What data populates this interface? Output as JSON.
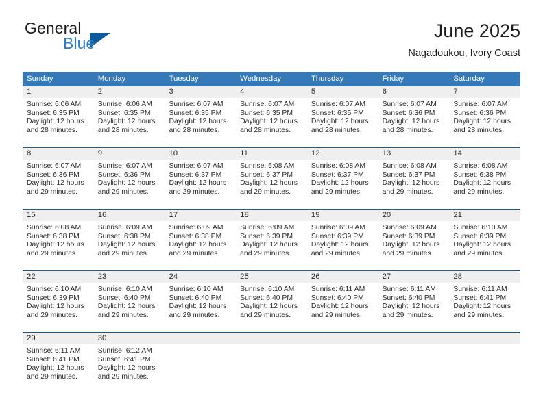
{
  "brand": {
    "name_part1": "General",
    "name_part2": "Blue",
    "triangle_color": "#0d5a9e",
    "blue_text_color": "#2b7cc4"
  },
  "header": {
    "title": "June 2025",
    "subtitle": "Nagadoukou, Ivory Coast"
  },
  "colors": {
    "header_band": "#3679b9",
    "week_rule": "#14609f",
    "day_band": "#efefef",
    "text": "#2b2b2b"
  },
  "weekdays": [
    "Sunday",
    "Monday",
    "Tuesday",
    "Wednesday",
    "Thursday",
    "Friday",
    "Saturday"
  ],
  "weeks": [
    {
      "days": [
        {
          "num": "1",
          "sunrise": "Sunrise: 6:06 AM",
          "sunset": "Sunset: 6:35 PM",
          "daylight1": "Daylight: 12 hours",
          "daylight2": "and 28 minutes."
        },
        {
          "num": "2",
          "sunrise": "Sunrise: 6:06 AM",
          "sunset": "Sunset: 6:35 PM",
          "daylight1": "Daylight: 12 hours",
          "daylight2": "and 28 minutes."
        },
        {
          "num": "3",
          "sunrise": "Sunrise: 6:07 AM",
          "sunset": "Sunset: 6:35 PM",
          "daylight1": "Daylight: 12 hours",
          "daylight2": "and 28 minutes."
        },
        {
          "num": "4",
          "sunrise": "Sunrise: 6:07 AM",
          "sunset": "Sunset: 6:35 PM",
          "daylight1": "Daylight: 12 hours",
          "daylight2": "and 28 minutes."
        },
        {
          "num": "5",
          "sunrise": "Sunrise: 6:07 AM",
          "sunset": "Sunset: 6:35 PM",
          "daylight1": "Daylight: 12 hours",
          "daylight2": "and 28 minutes."
        },
        {
          "num": "6",
          "sunrise": "Sunrise: 6:07 AM",
          "sunset": "Sunset: 6:36 PM",
          "daylight1": "Daylight: 12 hours",
          "daylight2": "and 28 minutes."
        },
        {
          "num": "7",
          "sunrise": "Sunrise: 6:07 AM",
          "sunset": "Sunset: 6:36 PM",
          "daylight1": "Daylight: 12 hours",
          "daylight2": "and 28 minutes."
        }
      ]
    },
    {
      "days": [
        {
          "num": "8",
          "sunrise": "Sunrise: 6:07 AM",
          "sunset": "Sunset: 6:36 PM",
          "daylight1": "Daylight: 12 hours",
          "daylight2": "and 29 minutes."
        },
        {
          "num": "9",
          "sunrise": "Sunrise: 6:07 AM",
          "sunset": "Sunset: 6:36 PM",
          "daylight1": "Daylight: 12 hours",
          "daylight2": "and 29 minutes."
        },
        {
          "num": "10",
          "sunrise": "Sunrise: 6:07 AM",
          "sunset": "Sunset: 6:37 PM",
          "daylight1": "Daylight: 12 hours",
          "daylight2": "and 29 minutes."
        },
        {
          "num": "11",
          "sunrise": "Sunrise: 6:08 AM",
          "sunset": "Sunset: 6:37 PM",
          "daylight1": "Daylight: 12 hours",
          "daylight2": "and 29 minutes."
        },
        {
          "num": "12",
          "sunrise": "Sunrise: 6:08 AM",
          "sunset": "Sunset: 6:37 PM",
          "daylight1": "Daylight: 12 hours",
          "daylight2": "and 29 minutes."
        },
        {
          "num": "13",
          "sunrise": "Sunrise: 6:08 AM",
          "sunset": "Sunset: 6:37 PM",
          "daylight1": "Daylight: 12 hours",
          "daylight2": "and 29 minutes."
        },
        {
          "num": "14",
          "sunrise": "Sunrise: 6:08 AM",
          "sunset": "Sunset: 6:38 PM",
          "daylight1": "Daylight: 12 hours",
          "daylight2": "and 29 minutes."
        }
      ]
    },
    {
      "days": [
        {
          "num": "15",
          "sunrise": "Sunrise: 6:08 AM",
          "sunset": "Sunset: 6:38 PM",
          "daylight1": "Daylight: 12 hours",
          "daylight2": "and 29 minutes."
        },
        {
          "num": "16",
          "sunrise": "Sunrise: 6:09 AM",
          "sunset": "Sunset: 6:38 PM",
          "daylight1": "Daylight: 12 hours",
          "daylight2": "and 29 minutes."
        },
        {
          "num": "17",
          "sunrise": "Sunrise: 6:09 AM",
          "sunset": "Sunset: 6:38 PM",
          "daylight1": "Daylight: 12 hours",
          "daylight2": "and 29 minutes."
        },
        {
          "num": "18",
          "sunrise": "Sunrise: 6:09 AM",
          "sunset": "Sunset: 6:39 PM",
          "daylight1": "Daylight: 12 hours",
          "daylight2": "and 29 minutes."
        },
        {
          "num": "19",
          "sunrise": "Sunrise: 6:09 AM",
          "sunset": "Sunset: 6:39 PM",
          "daylight1": "Daylight: 12 hours",
          "daylight2": "and 29 minutes."
        },
        {
          "num": "20",
          "sunrise": "Sunrise: 6:09 AM",
          "sunset": "Sunset: 6:39 PM",
          "daylight1": "Daylight: 12 hours",
          "daylight2": "and 29 minutes."
        },
        {
          "num": "21",
          "sunrise": "Sunrise: 6:10 AM",
          "sunset": "Sunset: 6:39 PM",
          "daylight1": "Daylight: 12 hours",
          "daylight2": "and 29 minutes."
        }
      ]
    },
    {
      "days": [
        {
          "num": "22",
          "sunrise": "Sunrise: 6:10 AM",
          "sunset": "Sunset: 6:39 PM",
          "daylight1": "Daylight: 12 hours",
          "daylight2": "and 29 minutes."
        },
        {
          "num": "23",
          "sunrise": "Sunrise: 6:10 AM",
          "sunset": "Sunset: 6:40 PM",
          "daylight1": "Daylight: 12 hours",
          "daylight2": "and 29 minutes."
        },
        {
          "num": "24",
          "sunrise": "Sunrise: 6:10 AM",
          "sunset": "Sunset: 6:40 PM",
          "daylight1": "Daylight: 12 hours",
          "daylight2": "and 29 minutes."
        },
        {
          "num": "25",
          "sunrise": "Sunrise: 6:10 AM",
          "sunset": "Sunset: 6:40 PM",
          "daylight1": "Daylight: 12 hours",
          "daylight2": "and 29 minutes."
        },
        {
          "num": "26",
          "sunrise": "Sunrise: 6:11 AM",
          "sunset": "Sunset: 6:40 PM",
          "daylight1": "Daylight: 12 hours",
          "daylight2": "and 29 minutes."
        },
        {
          "num": "27",
          "sunrise": "Sunrise: 6:11 AM",
          "sunset": "Sunset: 6:40 PM",
          "daylight1": "Daylight: 12 hours",
          "daylight2": "and 29 minutes."
        },
        {
          "num": "28",
          "sunrise": "Sunrise: 6:11 AM",
          "sunset": "Sunset: 6:41 PM",
          "daylight1": "Daylight: 12 hours",
          "daylight2": "and 29 minutes."
        }
      ]
    },
    {
      "days": [
        {
          "num": "29",
          "sunrise": "Sunrise: 6:11 AM",
          "sunset": "Sunset: 6:41 PM",
          "daylight1": "Daylight: 12 hours",
          "daylight2": "and 29 minutes."
        },
        {
          "num": "30",
          "sunrise": "Sunrise: 6:12 AM",
          "sunset": "Sunset: 6:41 PM",
          "daylight1": "Daylight: 12 hours",
          "daylight2": "and 29 minutes."
        },
        {
          "num": "",
          "sunrise": "",
          "sunset": "",
          "daylight1": "",
          "daylight2": ""
        },
        {
          "num": "",
          "sunrise": "",
          "sunset": "",
          "daylight1": "",
          "daylight2": ""
        },
        {
          "num": "",
          "sunrise": "",
          "sunset": "",
          "daylight1": "",
          "daylight2": ""
        },
        {
          "num": "",
          "sunrise": "",
          "sunset": "",
          "daylight1": "",
          "daylight2": ""
        },
        {
          "num": "",
          "sunrise": "",
          "sunset": "",
          "daylight1": "",
          "daylight2": ""
        }
      ]
    }
  ]
}
